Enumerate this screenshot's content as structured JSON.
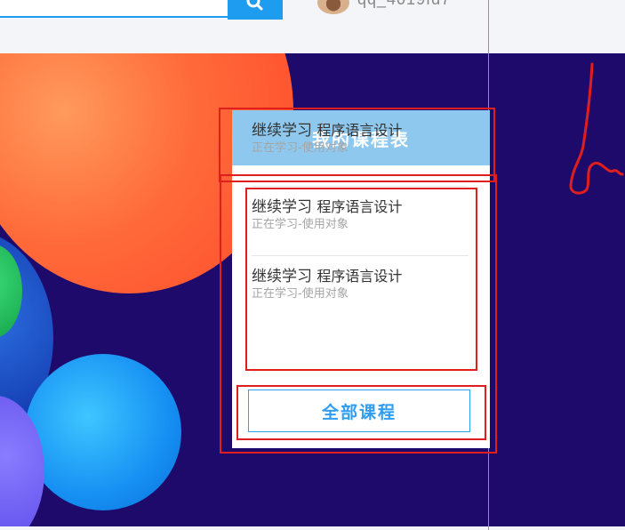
{
  "header": {
    "username": "qq_4019fd7",
    "search_placeholder": ""
  },
  "card": {
    "title": "我的课程表",
    "courses": [
      {
        "action": "继续学习",
        "name": "程序语言设计",
        "status": "正在学习-使用对象"
      },
      {
        "action": "继续学习",
        "name": "程序语言设计",
        "status": "正在学习-使用对象"
      },
      {
        "action": "继续学习",
        "name": "程序语言设计",
        "status": "正在学习-使用对象"
      }
    ],
    "all_courses_label": "全部课程"
  },
  "colors": {
    "accent": "#1e9cf0",
    "banner": "#1d0a6b",
    "card_header": "#8ec8ee",
    "annotation": "#e01e1e"
  },
  "icons": {
    "search": "search-icon",
    "avatar": "avatar"
  }
}
